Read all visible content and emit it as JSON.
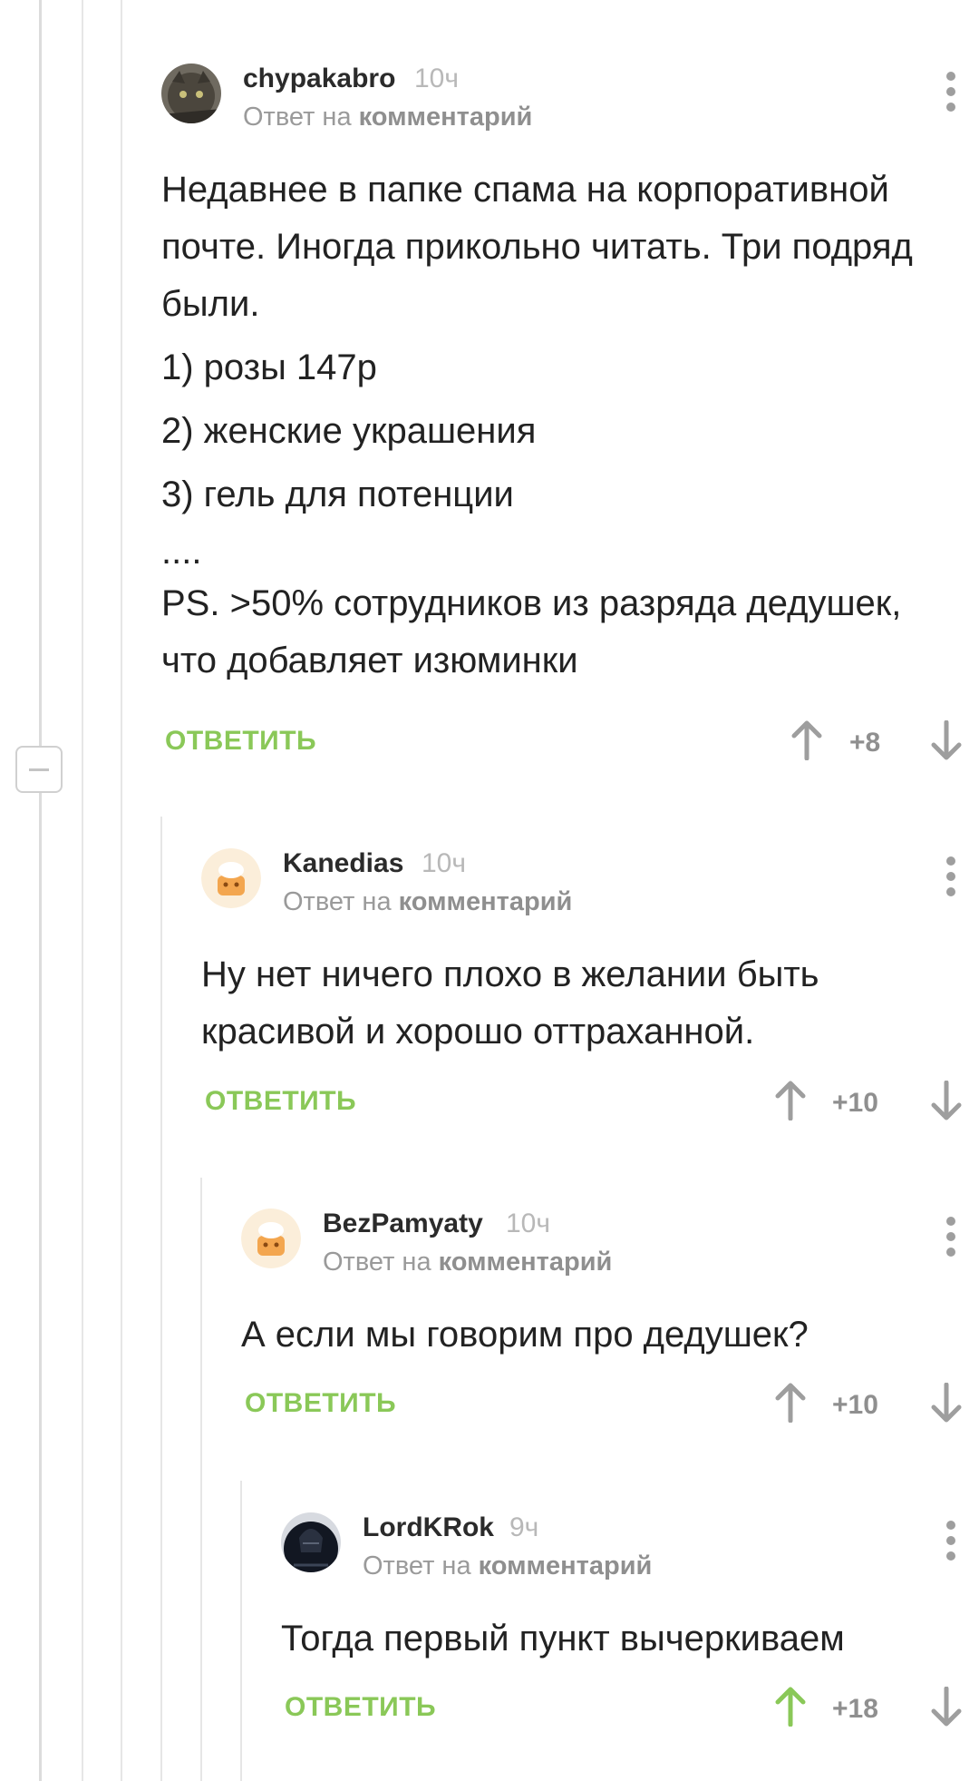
{
  "comments": [
    {
      "author": "chypakabro",
      "time": "10ч",
      "reply_prefix": "Ответ на",
      "reply_link": "комментарий",
      "paragraphs": [
        "Недавнее в папке спама на корпоративной почте. Иногда прикольно читать. Три подряд были.",
        "1) розы 147р",
        "2) женские украшения",
        "3) гель для потенции",
        "....",
        "PS. >50% сотрудников из разряда дедушек, что добавляет изюминки"
      ],
      "reply_label": "ОТВЕТИТЬ",
      "score": "+8",
      "upvoted": false
    },
    {
      "author": "Kanedias",
      "time": "10ч",
      "reply_prefix": "Ответ на",
      "reply_link": "комментарий",
      "paragraphs": [
        "Ну нет ничего плохо в желании быть красивой и хорошо оттраханной."
      ],
      "reply_label": "ОТВЕТИТЬ",
      "score": "+10",
      "upvoted": false
    },
    {
      "author": "BezPamyaty",
      "time": "10ч",
      "reply_prefix": "Ответ на",
      "reply_link": "комментарий",
      "paragraphs": [
        "А если мы говорим про дедушек?"
      ],
      "reply_label": "ОТВЕТИТЬ",
      "score": "+10",
      "upvoted": false
    },
    {
      "author": "LordKRok",
      "time": "9ч",
      "reply_prefix": "Ответ на",
      "reply_link": "комментарий",
      "paragraphs": [
        "Тогда первый пункт вычеркиваем"
      ],
      "reply_label": "ОТВЕТИТЬ",
      "score": "+18",
      "upvoted": true
    }
  ],
  "colors": {
    "accent_green": "#8ac858",
    "muted_gray": "#9e9e9e",
    "thread_line": "#e6e6e6"
  },
  "icons": {
    "avatar_1": "cat-photo-avatar",
    "avatar_2": "default-pikabu-avatar",
    "avatar_3": "default-pikabu-avatar",
    "avatar_4": "dark-armor-avatar",
    "more": "more-vertical-icon",
    "up": "arrow-up-icon",
    "down": "arrow-down-icon",
    "collapse": "collapse-minus-icon"
  }
}
